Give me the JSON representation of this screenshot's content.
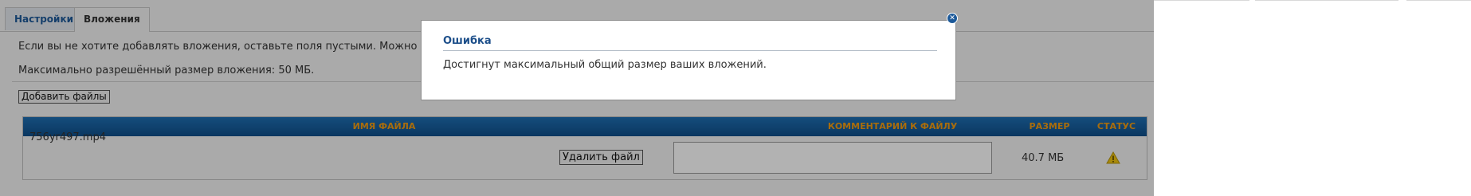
{
  "tabs": [
    {
      "label": "Настройки"
    },
    {
      "label": "Вложения"
    }
  ],
  "attachments": {
    "hint": "Если вы не хотите добавлять вложения, оставьте поля пустыми. Можно",
    "max_size_text": "Максимально разрешённый размер вложения: 50 МБ.",
    "add_files_label": "Добавить файлы"
  },
  "table": {
    "headers": {
      "name": "ИМЯ ФАЙЛА",
      "comment": "КОММЕНТАРИЙ К ФАЙЛУ",
      "size": "РАЗМЕР",
      "status": "СТАТУС"
    },
    "rows": [
      {
        "file_name": "756yr497.mp4",
        "delete_label": "Удалить файл",
        "comment_value": "",
        "size": "40.7 МБ",
        "status_icon": "warning-icon"
      }
    ]
  },
  "dialog": {
    "title": "Ошибка",
    "message": "Достигнут максимальный общий размер ваших вложений.",
    "close_icon": "close-icon"
  },
  "colors": {
    "header_bg": "#1f6fb3",
    "header_text": "#f39c12",
    "title_text": "#1d4f8a"
  }
}
